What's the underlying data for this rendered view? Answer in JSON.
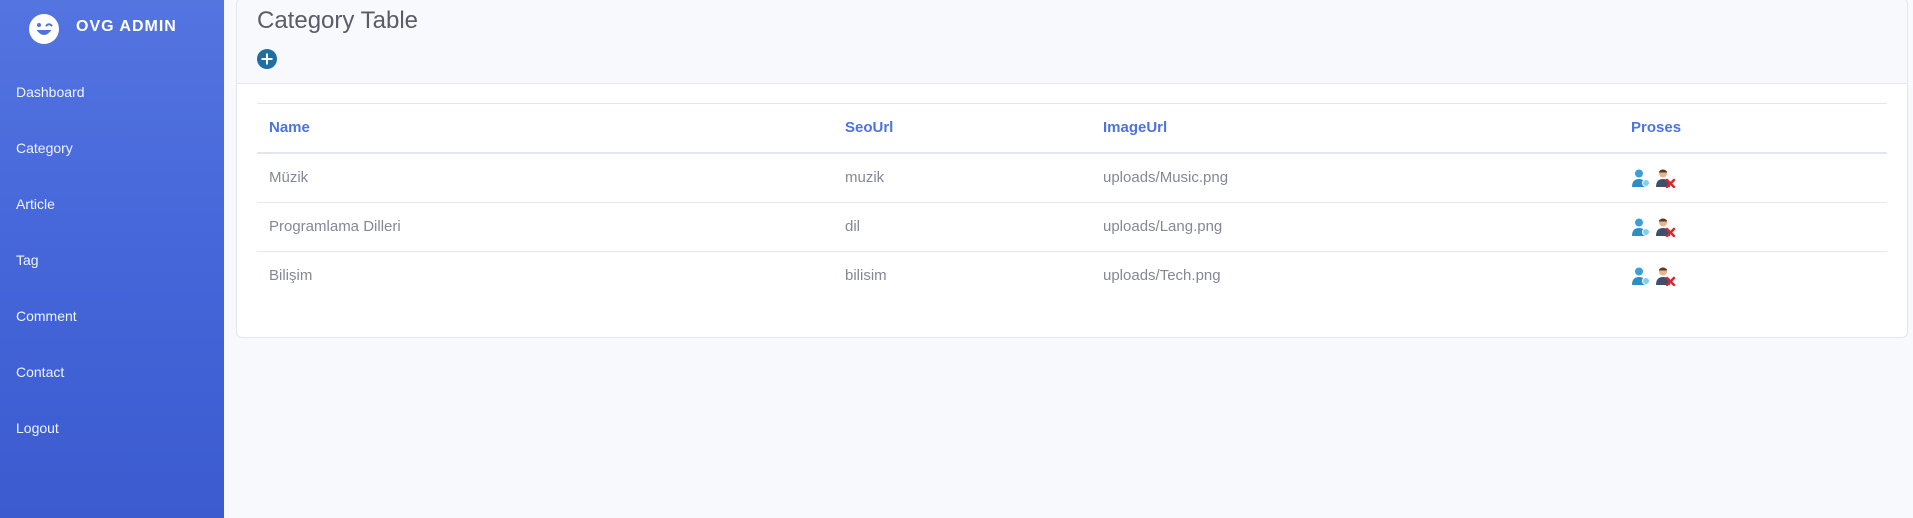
{
  "brand": {
    "title": "OVG ADMIN",
    "logo_icon": "laugh-wink-icon"
  },
  "sidebar": {
    "items": [
      {
        "label": "Dashboard"
      },
      {
        "label": "Category"
      },
      {
        "label": "Article"
      },
      {
        "label": "Tag"
      },
      {
        "label": "Comment"
      },
      {
        "label": "Contact"
      },
      {
        "label": "Logout"
      }
    ]
  },
  "page": {
    "title": "Category Table",
    "add_icon": "plus-circle-icon"
  },
  "table": {
    "headers": {
      "name": "Name",
      "seo": "SeoUrl",
      "image": "ImageUrl",
      "proses": "Proses"
    },
    "rows": [
      {
        "name": "Müzik",
        "seo": "muzik",
        "image": "uploads/Music.png"
      },
      {
        "name": "Programlama Dilleri",
        "seo": "dil",
        "image": "uploads/Lang.png"
      },
      {
        "name": "Bilişim",
        "seo": "bilisim",
        "image": "uploads/Tech.png"
      }
    ],
    "row_actions": [
      "user-edit-icon",
      "user-delete-icon"
    ]
  },
  "colors": {
    "sidebar_top": "#5474e0",
    "sidebar_bottom": "#3b5bcf",
    "accent": "#4e73df",
    "text_muted": "#858796",
    "title": "#5a5c69",
    "add_button": "#1f6fa3"
  }
}
